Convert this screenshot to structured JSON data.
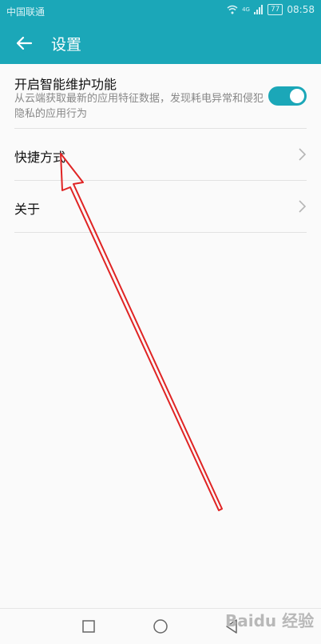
{
  "status": {
    "carrier": "中国联通",
    "battery": "77",
    "time": "08:58",
    "net_label": "4G"
  },
  "appbar": {
    "title": "设置"
  },
  "items": [
    {
      "label": "开启智能维护功能",
      "sub": "从云端获取最新的应用特征数据，发现耗电异常和侵犯隐私的应用行为",
      "toggle_on": true
    },
    {
      "label": "快捷方式"
    },
    {
      "label": "关于"
    }
  ],
  "watermark": "Baidu 经验",
  "colors": {
    "accent": "#1ba7b8",
    "annotation": "#e02424"
  },
  "icons": [
    "back-arrow-icon",
    "wifi-icon",
    "signal-icon",
    "battery-icon",
    "chevron-right-icon",
    "square-nav-icon",
    "circle-nav-icon",
    "triangle-nav-icon"
  ]
}
